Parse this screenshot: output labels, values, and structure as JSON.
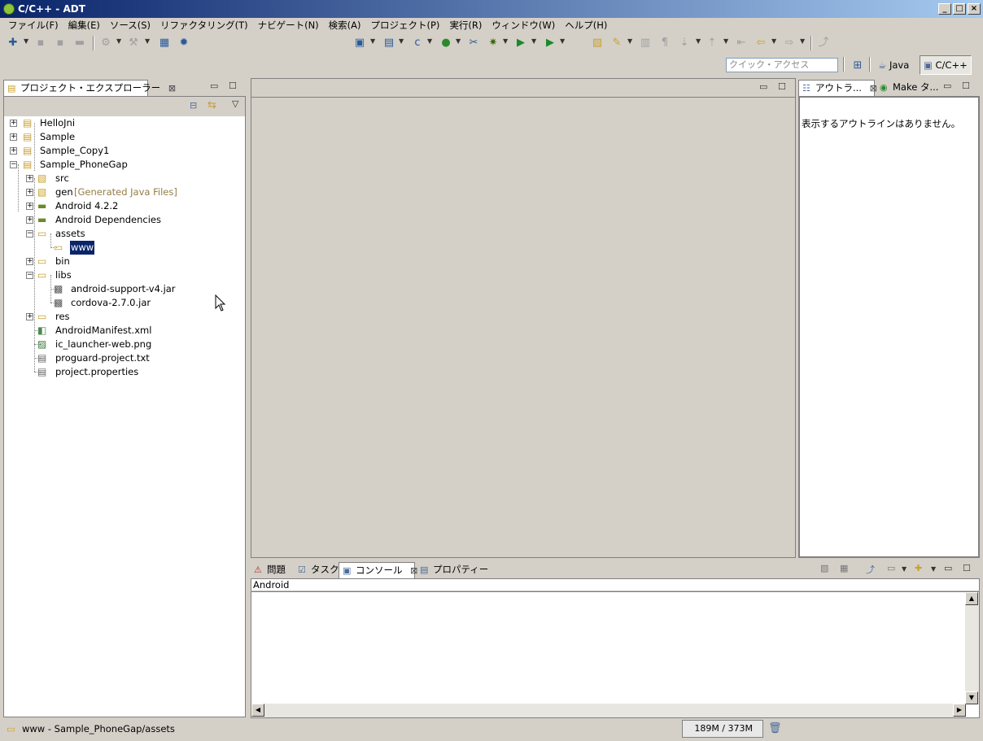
{
  "window": {
    "title": "C/C++ - ADT"
  },
  "menu": [
    "ファイル(F)",
    "編集(E)",
    "ソース(S)",
    "リファクタリング(T)",
    "ナビゲート(N)",
    "検索(A)",
    "プロジェクト(P)",
    "実行(R)",
    "ウィンドウ(W)",
    "ヘルプ(H)"
  ],
  "quick_access": {
    "placeholder": "クイック・アクセス"
  },
  "perspectives": {
    "java": "Java",
    "cpp": "C/C++"
  },
  "explorer": {
    "tab_label": "プロジェクト・エクスプローラー",
    "tree": [
      {
        "label": "HelloJni"
      },
      {
        "label": "Sample"
      },
      {
        "label": "Sample_Copy1"
      },
      {
        "label": "Sample_PhoneGap"
      },
      {
        "label": "src"
      },
      {
        "label": "gen",
        "extra": "[Generated Java Files]"
      },
      {
        "label": "Android 4.2.2"
      },
      {
        "label": "Android Dependencies"
      },
      {
        "label": "assets"
      },
      {
        "label": "www"
      },
      {
        "label": "bin"
      },
      {
        "label": "libs"
      },
      {
        "label": "android-support-v4.jar"
      },
      {
        "label": "cordova-2.7.0.jar"
      },
      {
        "label": "res"
      },
      {
        "label": "AndroidManifest.xml"
      },
      {
        "label": "ic_launcher-web.png"
      },
      {
        "label": "proguard-project.txt"
      },
      {
        "label": "project.properties"
      }
    ]
  },
  "outline": {
    "tab_label": "アウトラ...",
    "make_tab_label": "Make タ...",
    "empty_message": "表示するアウトラインはありません。"
  },
  "bottom": {
    "tabs": [
      "問題",
      "タスク",
      "コンソール",
      "プロパティー"
    ],
    "console_name": "Android"
  },
  "status": {
    "text": "www - Sample_PhoneGap/assets",
    "memory": "189M / 373M"
  }
}
